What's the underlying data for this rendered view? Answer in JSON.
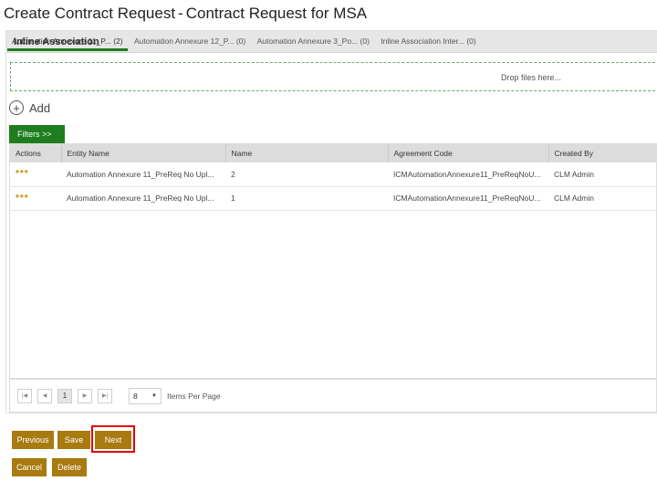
{
  "page": {
    "title_main": "Create Contract Request",
    "title_separator": "-",
    "title_sub": "Contract Request for MSA"
  },
  "panel": {
    "header": "Inline Association"
  },
  "tabs": [
    {
      "label": "Automation Annexure 11_P... (2)",
      "active": true
    },
    {
      "label": "Automation Annexure 12_P... (0)",
      "active": false
    },
    {
      "label": "Automation Annexure 3_Po... (0)",
      "active": false
    },
    {
      "label": "Inline Association Inter... (0)",
      "active": false
    }
  ],
  "dropzone": {
    "label": "Drop files here..."
  },
  "add": {
    "icon": "plus-circle-icon",
    "label": "Add"
  },
  "filters": {
    "label": "Filters >>"
  },
  "grid": {
    "columns": [
      "Actions",
      "Entity Name",
      "Name",
      "Agreement Code",
      "Created By"
    ],
    "rows": [
      {
        "actions": "***",
        "entity_name": "Automation Annexure 11_PreReq No Upl...",
        "name": "2",
        "agreement_code": "ICMAutomationAnnexure11_PreReqNoU...",
        "created_by": "CLM Admin"
      },
      {
        "actions": "***",
        "entity_name": "Automation Annexure 11_PreReq No Upl...",
        "name": "1",
        "agreement_code": "ICMAutomationAnnexure11_PreReqNoU...",
        "created_by": "CLM Admin"
      }
    ]
  },
  "pager": {
    "first": "|◀",
    "prev": "◀",
    "current_page": "1",
    "next": "▶",
    "last": "▶|",
    "page_size": "8",
    "page_size_caret": "▼",
    "items_per_page_label": "Items Per Page"
  },
  "actions": {
    "previous": "Previous",
    "save": "Save",
    "next": "Next",
    "cancel": "Cancel",
    "delete": "Delete"
  },
  "colors": {
    "accent_green": "#1e7d1e",
    "button_gold": "#a87a0f",
    "highlight_red": "#e00000"
  }
}
